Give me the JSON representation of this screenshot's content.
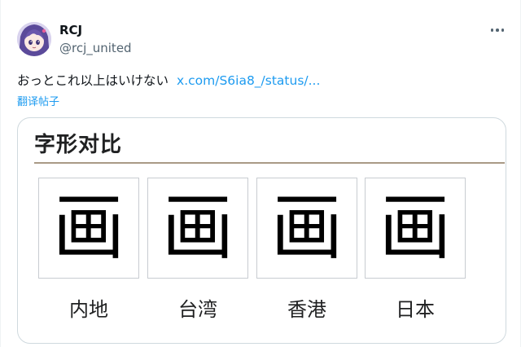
{
  "tweet": {
    "author": {
      "display_name": "RCJ",
      "handle": "@rcj_united"
    },
    "more_icon": "more-horizontal-icon",
    "text": "おっとこれ以上はいけない",
    "link": "x.com/S6ia8_/status/...",
    "translate_label": "翻译帖子"
  },
  "card": {
    "title": "字形对比",
    "glyphs": [
      {
        "char": "画",
        "region": "内地"
      },
      {
        "char": "画",
        "region": "台湾"
      },
      {
        "char": "画",
        "region": "香港"
      },
      {
        "char": "画",
        "region": "日本"
      }
    ]
  },
  "colors": {
    "link": "#1d9bf0",
    "secondary_text": "#536471",
    "card_border": "#cfd9de",
    "title_rule": "#a99a86"
  }
}
